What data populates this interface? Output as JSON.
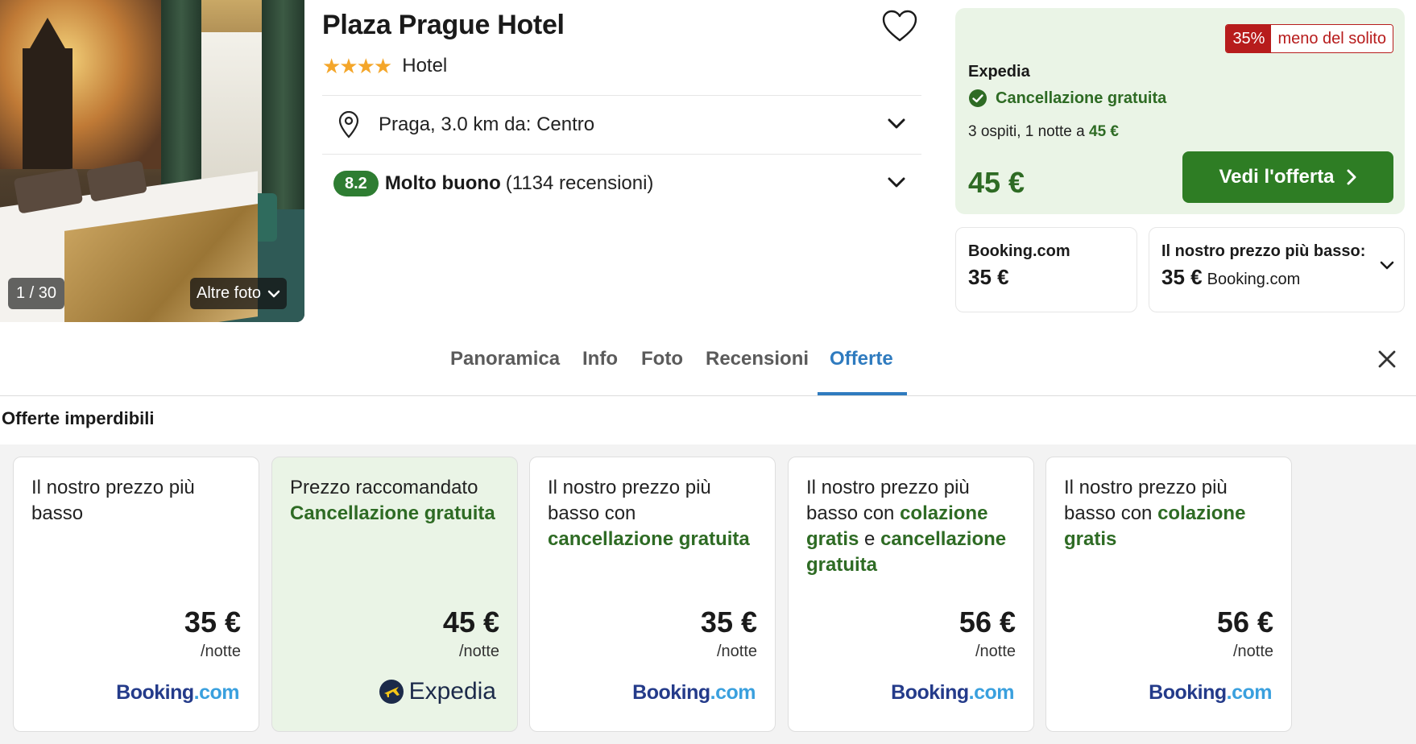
{
  "photo": {
    "counter": "1 / 30",
    "more_label": "Altre foto"
  },
  "hotel": {
    "name": "Plaza Prague Hotel",
    "stars": "★★★★",
    "type": "Hotel",
    "location": "Praga, 3.0 km da: Centro",
    "score": "8.2",
    "score_label": "Molto buono",
    "review_count": "(1134 recensioni)"
  },
  "deal": {
    "discount_pct": "35%",
    "discount_text": "meno del solito",
    "provider": "Expedia",
    "cancellation": "Cancellazione gratuita",
    "guests_prefix": "3 ospiti, 1 notte a",
    "guests_price": "45 €",
    "price": "45 €",
    "button_label": "Vedi l'offerta",
    "accent_color": "#2e7d24",
    "background_color": "#eaf4e6"
  },
  "alt_boxes": [
    {
      "title": "Booking.com",
      "price": "35 €"
    },
    {
      "title": "Il nostro prezzo più basso:",
      "price": "35 €",
      "provider": "Booking.com"
    }
  ],
  "tabs": [
    {
      "label": "Panoramica"
    },
    {
      "label": "Info"
    },
    {
      "label": "Foto"
    },
    {
      "label": "Recensioni"
    },
    {
      "label": "Offerte",
      "active": true
    }
  ],
  "section_title": "Offerte imperdibili",
  "offers": [
    {
      "title_plain": "Il nostro prezzo più basso",
      "price": "35 €",
      "unit": "/notte",
      "provider": "Booking.com",
      "provider_a": "Booking",
      "provider_b": ".com"
    },
    {
      "title_plain": "Prezzo raccomandato",
      "title_green": "Cancellazione gratuita",
      "price": "45 €",
      "unit": "/notte",
      "provider": "Expedia"
    },
    {
      "title_plain": "Il nostro prezzo più basso con",
      "title_green": "cancellazione gratuita",
      "price": "35 €",
      "unit": "/notte",
      "provider": "Booking.com",
      "provider_a": "Booking",
      "provider_b": ".com"
    },
    {
      "title_plain": "Il nostro prezzo più basso con",
      "title_green": "colazione gratis",
      "title_mid": "e",
      "title_green2": "cancellazione gratuita",
      "price": "56 €",
      "unit": "/notte",
      "provider": "Booking.com",
      "provider_a": "Booking",
      "provider_b": ".com"
    },
    {
      "title_plain": "Il nostro prezzo più basso con",
      "title_green": "colazione gratis",
      "price": "56 €",
      "unit": "/notte",
      "provider": "Booking.com",
      "provider_a": "Booking",
      "provider_b": ".com"
    }
  ],
  "icons": {
    "heart": "heart-icon",
    "pin": "location-pin-icon",
    "chevron": "chevron-down-icon",
    "check": "check-circle-icon",
    "arrow": "chevron-right-icon",
    "close": "close-icon"
  }
}
